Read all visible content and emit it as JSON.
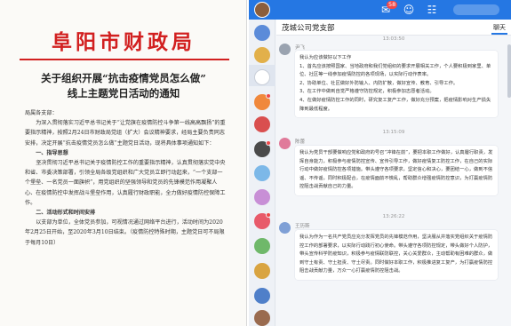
{
  "doc": {
    "header": "阜阳市财政局",
    "title_line1": "关于组织开展“抗击疫情党员怎么做”",
    "title_line2": "线上主题党日活动的通知",
    "salutation": "局属各支部：",
    "intro": "为深入贯彻落实习近平总书记关于“让党旗在疫情防控斗争第一线高高飘扬”的重要指示精神，按照2月24日市财政局党组（扩大）会议精神要求，经局主要负责同志安排，决定开展“抗击疫情党员怎么做”主题党日活动，现将具体事项通知如下：",
    "sec1": "一、指导思想",
    "sec1_text": "坚决贯彻习近平总书记关于疫情防控工作的重要指示精神，认真贯彻落实党中央和省、市委决策部署，引领全局各级党组织和广大党员立即行动起来，“一个支部一个堡垒、一名党员一面旗帜”，用党组织的坚强领导和党员的先锋模范作用凝聚人心、在疫情防控中发挥战斗堡垒作用，认真履行财政职能，全力做好疫情防控保障工作。",
    "sec2": "二、活动形式和时间安排",
    "sec2_text": "以支部为单位，全体党员参加，可视情况通过网络平台进行，活动时间为2020年2月25日开始，至2020年3月10日结束。（疫情防控特殊时期，主题党日可不局限于每月10日）"
  },
  "app": {
    "chat_title": "茂城公司党支部",
    "tab_label": "聊天",
    "badge_count": "58",
    "messages": [
      {
        "time": "13:03:50",
        "sender": "尹飞",
        "avatar_color": "#9aa3b0",
        "lines": [
          "我认为应该做好以下工作",
          "1、首先应该按照国家、当地政府和我们党组织的要求开展相关工作，个人要积极到家里、单位、社区等一线参加疫情防控的各项现场，以实际行动作表率。",
          "2、协助单位、社区做好外防输入、内防扩散，做好宣传、教育、引导工作。",
          "3、在工作中做到自觉严格遵守防控规定，积极参加志愿者活动。",
          "4、在做好疫情防控工作的同时，研究复工复产工作，做好充分预案，把疫情影响对生产损失降到最低程度。"
        ]
      },
      {
        "time": "13:15:09",
        "sender": "陈蕾",
        "avatar_color": "#e07a9a",
        "lines": [
          "我认为党员干部要做响应党和政府的号召“冲锋在前”，要把本职工作做好，认真履行职责，发挥自身能力，积极参与疫情防控宣传、宣传引导工作，做好疫情复工防控工作，在自己的实际行动中做好疫情防控各项措施。带头遵守各项要求，坚定信心和决心，要团结一心，做到不信谣、不传谣，同时积极配合，在疫情面前不慌乱，帮助群众增强疫情防控意识，为打赢疫情防控阻击战贡献自己的力量。"
        ]
      },
      {
        "time": "13:26:22",
        "sender": "王历斯",
        "avatar_color": "#7fa0d6",
        "lines": [
          "我认为作为一名共产党员应充分发挥党员的先锋模范作用，坚决服从并落实党组织关于疫情防控工作的部署要求，以实际行动践行初心使命。带头遵守各项防控规定，带头做好个人防护，带头宣传科学防疫知识，积极参与疫情联防联控，关心关爱群众，主动帮助有困难的群众，做到守土有责、守土担责、守土尽责。同时做好本职工作，积极推进复工复产，为打赢疫情防控阻击战贡献力量，万众一心打赢疫情防控阻击战。"
        ]
      }
    ]
  }
}
